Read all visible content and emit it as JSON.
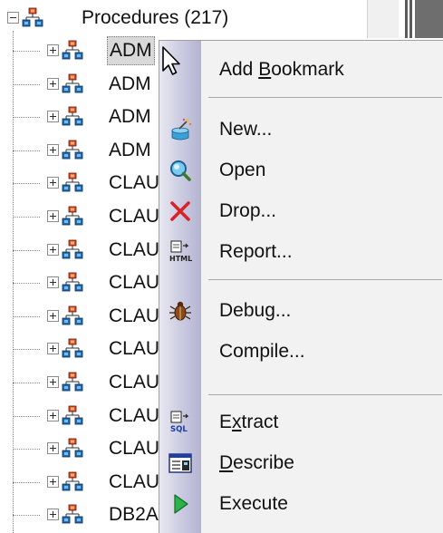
{
  "tree": {
    "root": {
      "label": "Procedures (217)",
      "expanded": true
    },
    "items": [
      {
        "label": "ADM"
      },
      {
        "label": "ADM"
      },
      {
        "label": "ADM"
      },
      {
        "label": "ADM"
      },
      {
        "label": "CLAU"
      },
      {
        "label": "CLAU"
      },
      {
        "label": "CLAU"
      },
      {
        "label": "CLAU"
      },
      {
        "label": "CLAU"
      },
      {
        "label": "CLAU"
      },
      {
        "label": "CLAU"
      },
      {
        "label": "CLAU"
      },
      {
        "label": "CLAU"
      },
      {
        "label": "CLAU"
      },
      {
        "label": "DB2A"
      }
    ],
    "selected_index": 0
  },
  "context_menu": {
    "items": [
      {
        "label": "Add Bookmark",
        "mnemonic": "B",
        "icon": ""
      },
      {
        "label": "New...",
        "mnemonic": "",
        "icon": "new-wand-icon"
      },
      {
        "label": "Open",
        "mnemonic": "",
        "icon": "open-magnifier-icon"
      },
      {
        "label": "Drop...",
        "mnemonic": "",
        "icon": "drop-x-icon"
      },
      {
        "label": "Report...",
        "mnemonic": "",
        "icon": "html-report-icon",
        "icon_text": "HTML"
      },
      {
        "label": "Debug...",
        "mnemonic": "",
        "icon": "debug-bug-icon"
      },
      {
        "label": "Compile...",
        "mnemonic": "",
        "icon": ""
      },
      {
        "label": "Extract",
        "mnemonic": "x",
        "icon": "sql-extract-icon",
        "icon_text": "SQL"
      },
      {
        "label": "Describe",
        "mnemonic": "D",
        "icon": "describe-icon"
      },
      {
        "label": "Execute",
        "mnemonic": "",
        "icon": "execute-play-icon"
      }
    ]
  },
  "colors": {
    "menu_bg": "#f2f2f2",
    "gutter": "#c9c9e0",
    "selection": "#d9d9d9",
    "drop_red": "#d8232a",
    "execute_green": "#2bb34a"
  }
}
